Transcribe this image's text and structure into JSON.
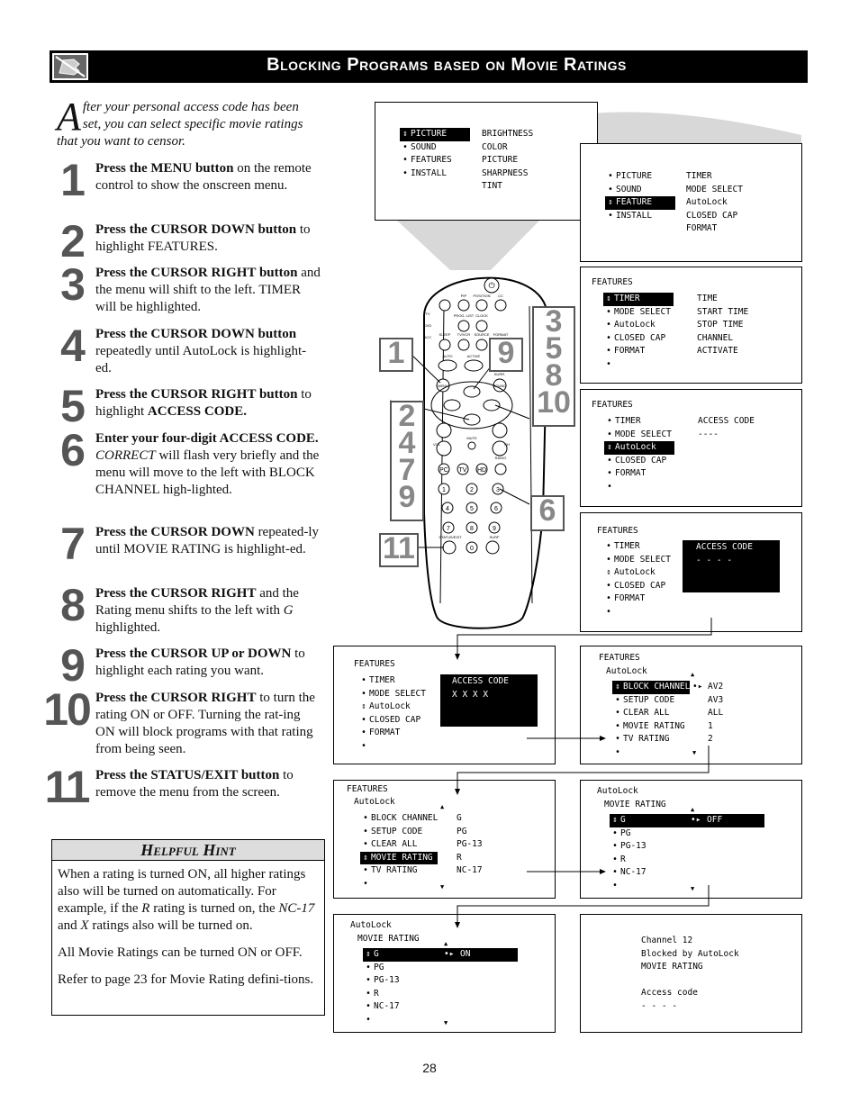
{
  "header": {
    "title": "Blocking Programs based on Movie Ratings",
    "icon": "hand-pointing-icon"
  },
  "intro": {
    "drop_cap": "A",
    "text": "fter your personal access code has been set, you can select specific movie ratings that you want to censor."
  },
  "steps": [
    {
      "num": "1",
      "bold": "Press the MENU button",
      "rest": " on the remote control to show the onscreen menu."
    },
    {
      "num": "2",
      "bold": "Press the CURSOR DOWN button",
      "rest": " to highlight FEATURES."
    },
    {
      "num": "3",
      "bold": "Press the CURSOR RIGHT button",
      "rest": " and the menu will shift to the left. TIMER will be highlighted."
    },
    {
      "num": "4",
      "bold": "Press the CURSOR DOWN button",
      "rest": " repeatedly until AutoLock is highlight-ed."
    },
    {
      "num": "5",
      "bold": "Press the CURSOR RIGHT button",
      "rest": " to highlight ",
      "bold2": "ACCESS CODE."
    },
    {
      "num": "6",
      "bold": "Enter your four-digit ACCESS CODE.",
      "italic": " CORRECT",
      "rest": " will flash very briefly and the menu will move to the left with BLOCK CHANNEL high-lighted."
    },
    {
      "num": "7",
      "bold": "Press the CURSOR DOWN",
      "rest": " repeated-ly until MOVIE RATING is highlight-ed."
    },
    {
      "num": "8",
      "bold": "Press the CURSOR RIGHT",
      "rest": " and the Rating menu shifts to the left with ",
      "italic": "G",
      "rest2": " highlighted."
    },
    {
      "num": "9",
      "bold": "Press the CURSOR UP or DOWN",
      "rest": " to highlight each rating you want."
    },
    {
      "num": "10",
      "bold": "Press the CURSOR RIGHT",
      "rest": " to turn the rating ON or OFF.  Turning the rat-ing ON will block programs with that rating from being seen."
    },
    {
      "num": "11",
      "bold": "Press the STATUS/EXIT button",
      "rest": " to remove the menu from the screen."
    }
  ],
  "hint": {
    "title": "Helpful Hint",
    "p1a": "When a rating is turned ON, all higher ratings also will be turned on automatically.  For example, if the ",
    "p1_r": "R",
    "p1b": " rating is turned on, the ",
    "p1_nc": "NC-17",
    "p1c": " and ",
    "p1_x": "X",
    "p1d": " ratings also will be turned on.",
    "p2": "All Movie Ratings can be turned ON or OFF.",
    "p3": "Refer to page 23 for Movie Rating defini-tions."
  },
  "screens": {
    "s1": {
      "menu": [
        "PICTURE",
        "SOUND",
        "FEATURES",
        "INSTALL"
      ],
      "selected": 0,
      "sub": [
        "BRIGHTNESS",
        "COLOR",
        "PICTURE",
        "SHARPNESS",
        "TINT"
      ]
    },
    "s2": {
      "menu": [
        "PICTURE",
        "SOUND",
        "FEATURE",
        "INSTALL"
      ],
      "selected": 2,
      "sub": [
        "TIMER",
        "MODE SELECT",
        "AutoLock",
        "CLOSED CAP",
        "FORMAT"
      ]
    },
    "s3": {
      "title": "FEATURES",
      "menu": [
        "TIMER",
        "MODE SELECT",
        "AutoLock",
        "CLOSED CAP",
        "FORMAT",
        ""
      ],
      "selected": 0,
      "sub": [
        "TIME",
        "START TIME",
        "STOP TIME",
        "CHANNEL",
        "ACTIVATE"
      ]
    },
    "s4": {
      "title": "FEATURES",
      "menu": [
        "TIMER",
        "MODE SELECT",
        "AutoLock",
        "CLOSED CAP",
        "FORMAT",
        ""
      ],
      "selected": 2,
      "sub": [
        "ACCESS CODE",
        "----"
      ]
    },
    "s5": {
      "title": "FEATURES",
      "menu": [
        "TIMER",
        "MODE SELECT",
        "AutoLock",
        "CLOSED CAP",
        "FORMAT",
        ""
      ],
      "box_title": "ACCESS CODE",
      "box_value": "- - - -"
    },
    "s6": {
      "title": "FEATURES",
      "menu": [
        "TIMER",
        "MODE SELECT",
        "AutoLock",
        "CLOSED CAP",
        "FORMAT",
        ""
      ],
      "box_title": "ACCESS CODE",
      "box_value": "X X X X"
    },
    "s7": {
      "title": "FEATURES",
      "subtitle": "AutoLock",
      "menu": [
        "BLOCK CHANNEL",
        "SETUP CODE",
        "CLEAR ALL",
        "MOVIE RATING",
        "TV RATING",
        ""
      ],
      "selected": 0,
      "sub": [
        "AV2",
        "AV3",
        "ALL",
        "1",
        "2"
      ]
    },
    "s8": {
      "title": "FEATURES",
      "subtitle": "AutoLock",
      "menu": [
        "BLOCK CHANNEL",
        "SETUP CODE",
        "CLEAR ALL",
        "MOVIE RATING",
        "TV RATING",
        ""
      ],
      "selected": 3,
      "sub": [
        "G",
        "PG",
        "PG-13",
        "R",
        "NC-17"
      ]
    },
    "s9": {
      "title": "AutoLock",
      "subtitle": "MOVIE RATING",
      "menu": [
        "G",
        "PG",
        "PG-13",
        "R",
        "NC-17",
        ""
      ],
      "selected": 0,
      "value": "OFF"
    },
    "s10": {
      "title": "AutoLock",
      "subtitle": "MOVIE RATING",
      "menu": [
        "G",
        "PG",
        "PG-13",
        "R",
        "NC-17",
        ""
      ],
      "selected": 0,
      "value": "ON"
    },
    "s11": {
      "lines": [
        "Channel 12",
        "Blocked by AutoLock",
        "MOVIE RATING",
        "",
        "Access code",
        "- - - -"
      ]
    }
  },
  "remote": {
    "labels": {
      "pip": "PIP",
      "position": "POSITION",
      "cc": "CC",
      "tv": "TV",
      "dvd": "DVD",
      "acc": "ACC",
      "prog_list": "PROG. LIST",
      "clock": "CLOCK",
      "sleep": "SLEEP",
      "tvvcr": "TV/VCR",
      "source": "SOURCE",
      "format": "FORMAT",
      "avch": "A/CH",
      "auto": "AUTO",
      "active": "ACTIVE",
      "sound": "SOUND",
      "control": "CONTROL",
      "menu": "MENU",
      "surr": "SURR.",
      "vol": "VOL",
      "ch": "CH",
      "mute": "MUTE",
      "radio": "RADIO",
      "pc": "PC",
      "tvb": "TV",
      "hd": "HD",
      "status": "STATUS/EXIT",
      "surf": "SURF"
    },
    "digits": [
      "1",
      "2",
      "3",
      "4",
      "5",
      "6",
      "7",
      "8",
      "9",
      "0"
    ],
    "callouts": {
      "c1": "1",
      "c9": "9",
      "c3": "3\n5\n8\n10",
      "c2": "2\n4\n7\n9",
      "c6": "6",
      "c11": "11"
    }
  },
  "page_number": "28"
}
